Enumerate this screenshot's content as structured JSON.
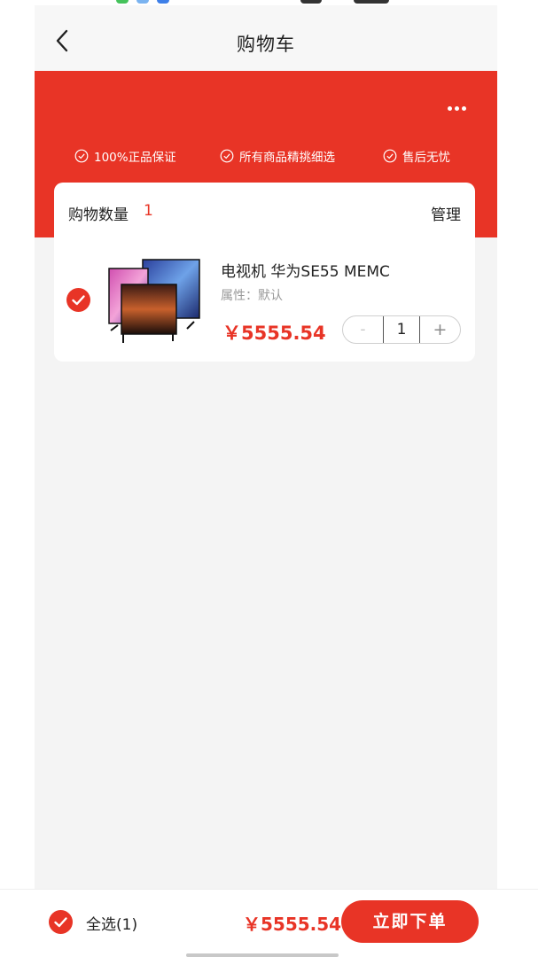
{
  "nav": {
    "title": "购物车"
  },
  "banner": {
    "guarantees": [
      "100%正品保证",
      "所有商品精挑细选",
      "售后无忧"
    ]
  },
  "cart": {
    "count_label": "购物数量",
    "count": "1",
    "manage_label": "管理",
    "items": [
      {
        "title": "电视机 华为SE55 MEMC",
        "attr": "属性：默认",
        "price": "￥5555.54",
        "quantity": "1",
        "minus": "-",
        "plus": "+",
        "checked": true
      }
    ]
  },
  "footer": {
    "select_all_label": "全选(1)",
    "total": "￥5555.54",
    "submit_label": "立即下单"
  },
  "colors": {
    "accent": "#e83426",
    "background": "#f4f4f4",
    "card": "#ffffff"
  },
  "icons": {
    "back": "chevron-left-icon",
    "more": "more-dots-icon",
    "check": "check-circle-icon"
  }
}
